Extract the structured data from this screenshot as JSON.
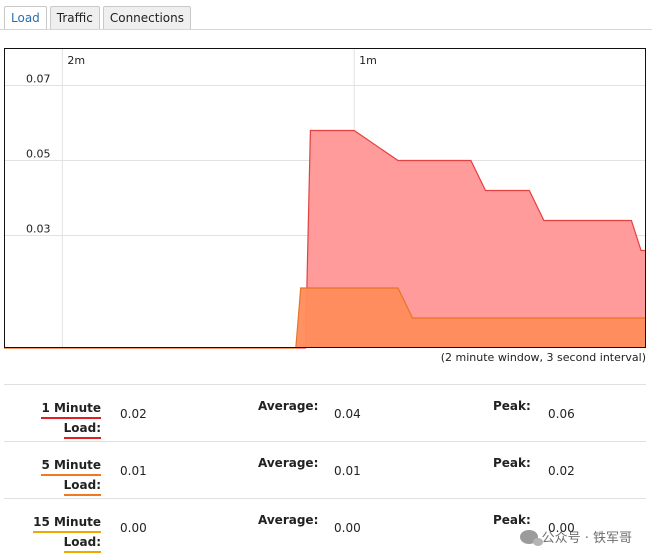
{
  "tabs": [
    {
      "label": "Load",
      "active": true
    },
    {
      "label": "Traffic",
      "active": false
    },
    {
      "label": "Connections",
      "active": false
    }
  ],
  "chart_caption": "(2 minute window, 3 second interval)",
  "chart_data": {
    "type": "area",
    "x_tick_labels": [
      {
        "x": -120,
        "label": "2m"
      },
      {
        "x": -60,
        "label": "1m"
      }
    ],
    "y_tick_labels": [
      {
        "y": 0.07,
        "label": "0.07"
      },
      {
        "y": 0.05,
        "label": "0.05"
      },
      {
        "y": 0.03,
        "label": "0.03"
      }
    ],
    "xlim": [
      -132,
      0
    ],
    "ylim": [
      0,
      0.08
    ],
    "grid": true,
    "series": [
      {
        "color": "#ff9b9b",
        "line_color": "#e44040",
        "points": [
          [
            -132,
            0
          ],
          [
            -70,
            0
          ],
          [
            -69,
            0.058
          ],
          [
            -60,
            0.058
          ],
          [
            -51,
            0.05
          ],
          [
            -36,
            0.05
          ],
          [
            -33,
            0.042
          ],
          [
            -24,
            0.042
          ],
          [
            -21,
            0.034
          ],
          [
            -3,
            0.034
          ],
          [
            -1,
            0.026
          ],
          [
            0,
            0.026
          ]
        ]
      },
      {
        "color": "#ff8c5a",
        "line_color": "#e8742a",
        "points": [
          [
            -132,
            0
          ],
          [
            -72,
            0
          ],
          [
            -71,
            0.016
          ],
          [
            -60,
            0.016
          ],
          [
            -51,
            0.016
          ],
          [
            -48,
            0.008
          ],
          [
            0,
            0.008
          ]
        ]
      }
    ]
  },
  "stats": [
    {
      "name_line1": "1 Minute",
      "name_line2": "Load:",
      "underline": "#e02020",
      "current": "0.02",
      "avg_label": "Average:",
      "avg": "0.04",
      "peak_label": "Peak:",
      "peak": "0.06"
    },
    {
      "name_line1": "5 Minute",
      "name_line2": "Load:",
      "underline": "#f07820",
      "current": "0.01",
      "avg_label": "Average:",
      "avg": "0.01",
      "peak_label": "Peak:",
      "peak": "0.02"
    },
    {
      "name_line1": "15 Minute",
      "name_line2": "Load:",
      "underline": "#f0a800",
      "current": "0.00",
      "avg_label": "Average:",
      "avg": "0.00",
      "peak_label": "Peak:",
      "peak": "0.00"
    }
  ],
  "watermark": {
    "text": "公众号 · 铁军哥",
    "icon": "wechat-icon"
  }
}
